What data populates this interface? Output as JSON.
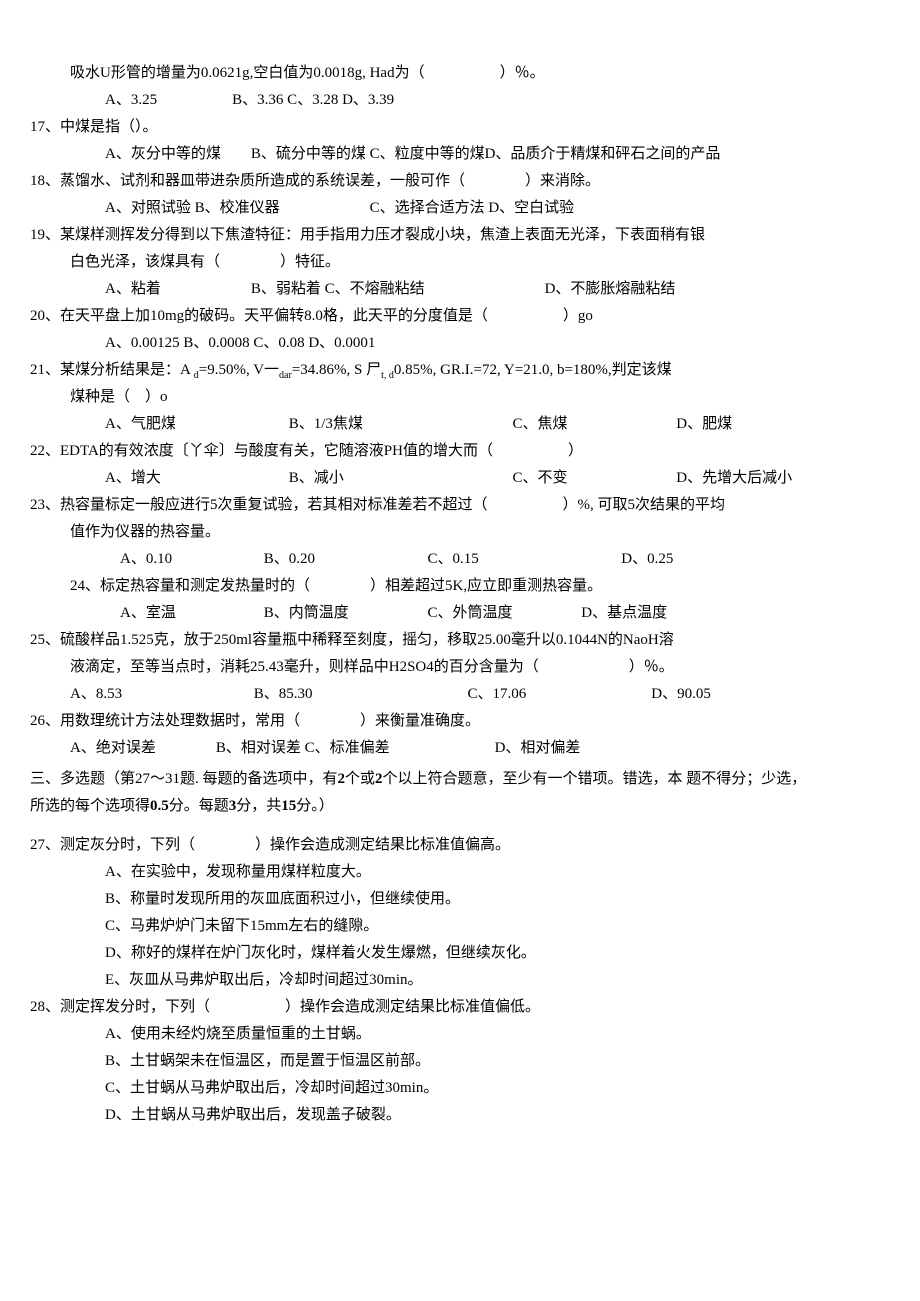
{
  "q16_cont": {
    "stem": "吸水U形管的增量为0.0621g,空白值为0.0018g, Had为（　　　　　）％。",
    "opts": "A、3.25　　　　　B、3.36 C、3.28 D、3.39"
  },
  "q17": {
    "stem": "17、中煤是指（）。",
    "opts": "A、灰分中等的煤　　B、硫分中等的煤 C、粒度中等的煤D、品质介于精煤和砰石之间的产品"
  },
  "q18": {
    "stem": "18、蒸馏水、试剂和器皿带进杂质所造成的系统误差，一般可作（　　　　）来消除。",
    "opts": "A、对照试验 B、校准仪器　　　　　　C、选择合适方法 D、空白试验"
  },
  "q19": {
    "stem1": "19、某煤样测挥发分得到以下焦渣特征：用手指用力压才裂成小块，焦渣上表面无光泽，下表面稍有银",
    "stem2": "白色光泽，该煤具有（　　　　）特征。",
    "opts": "A、粘着　　　　　　B、弱粘着 C、不熔融粘结　　　　　　　　D、不膨胀熔融粘结"
  },
  "q20": {
    "stem": "20、在天平盘上加10mg的破码。天平偏转8.0格，此天平的分度值是（　　　　　）go",
    "opts": "A、0.00125 B、0.0008 C、0.08 D、0.0001"
  },
  "q21": {
    "stem1_pre": "21、某煤分析结果是：A ",
    "stem1_mid1": "=9.50%, V一",
    "stem1_mid2": "=34.86%, S 尸",
    "stem1_mid3": "0.85%, GR.I.=72, Y=21.0, b=180%,判定该煤",
    "sub1": "d",
    "sub2": "dar",
    "sub3": "t, d",
    "stem2": "煤种是（　）o",
    "optA": "A、气肥煤",
    "optB": "B、1/3焦煤",
    "optC": "C、焦煤",
    "optD": "D、肥煤"
  },
  "q22": {
    "stem": "22、EDTA的有效浓度〔丫伞〕与酸度有关，它随溶液PH值的增大而（　　　　　）",
    "optA": "A、增大",
    "optB": "B、减小",
    "optC": "C、不变",
    "optD": "D、先增大后减小"
  },
  "q23": {
    "stem1": "23、热容量标定一般应进行5次重复试验，若其相对标准差若不超过（　　　　　）%, 可取5次结果的平均",
    "stem2": "值作为仪器的热容量。",
    "optA": "A、0.10",
    "optB": "B、0.20",
    "optC": "C、0.15",
    "optD": "D、0.25"
  },
  "q24": {
    "stem": "24、标定热容量和测定发热量时的（　　　　）相差超过5K,应立即重测热容量。",
    "optA": "A、室温",
    "optB": "B、内筒温度",
    "optC": "C、外筒温度",
    "optD": "D、基点温度"
  },
  "q25": {
    "stem1": "25、硫酸样品1.525克，放于250ml容量瓶中稀释至刻度，摇匀，移取25.00毫升以0.1044N的NaoH溶",
    "stem2": "液滴定，至等当点时，消耗25.43毫升，则样品中H2SO4的百分含量为（　　　　　　）％。",
    "optA": "A、8.53",
    "optB": "B、85.30",
    "optC": "C、17.06",
    "optD": "D、90.05"
  },
  "q26": {
    "stem": "26、用数理统计方法处理数据时，常用（　　　　）来衡量准确度。",
    "opts": "A、绝对误差　　　　B、相对误差 C、标准偏差　　　　　　　D、相对偏差"
  },
  "section3": {
    "l1_pre": "三、多选题（第27〜31题. 每题的备选项中，有",
    "l1_b1": "2",
    "l1_m1": "个或",
    "l1_b2": "2",
    "l1_m2": "个以上符合题意，至少有一个错项。错选，本 题不得分；少选，",
    "l2_pre": "所选的每个选项得",
    "l2_b1": "0.5",
    "l2_m1": "分。每题",
    "l2_b2": "3",
    "l2_m2": "分，共",
    "l2_b3": "15",
    "l2_m3": "分。）"
  },
  "q27": {
    "stem": "27、测定灰分时，下列（　　　　）操作会造成测定结果比标准值偏高。",
    "a": "A、在实验中，发现称量用煤样粒度大。",
    "b": "B、称量时发现所用的灰皿底面积过小，但继续使用。",
    "c": "C、马弗炉炉门未留下15mm左右的缝隙。",
    "d": "D、称好的煤样在炉门灰化时，煤样着火发生爆燃，但继续灰化。",
    "e": "E、灰皿从马弗炉取出后，冷却时间超过30min。"
  },
  "q28": {
    "stem": "28、测定挥发分时，下列（　　　　　）操作会造成测定结果比标准值偏低。",
    "a": "A、使用未经灼烧至质量恒重的土甘蜗。",
    "b": "B、土甘蜗架未在恒温区，而是置于恒温区前部。",
    "c": "C、土甘蜗从马弗炉取出后，冷却时间超过30min。",
    "d": "D、土甘蜗从马弗炉取出后，发现盖子破裂。"
  }
}
